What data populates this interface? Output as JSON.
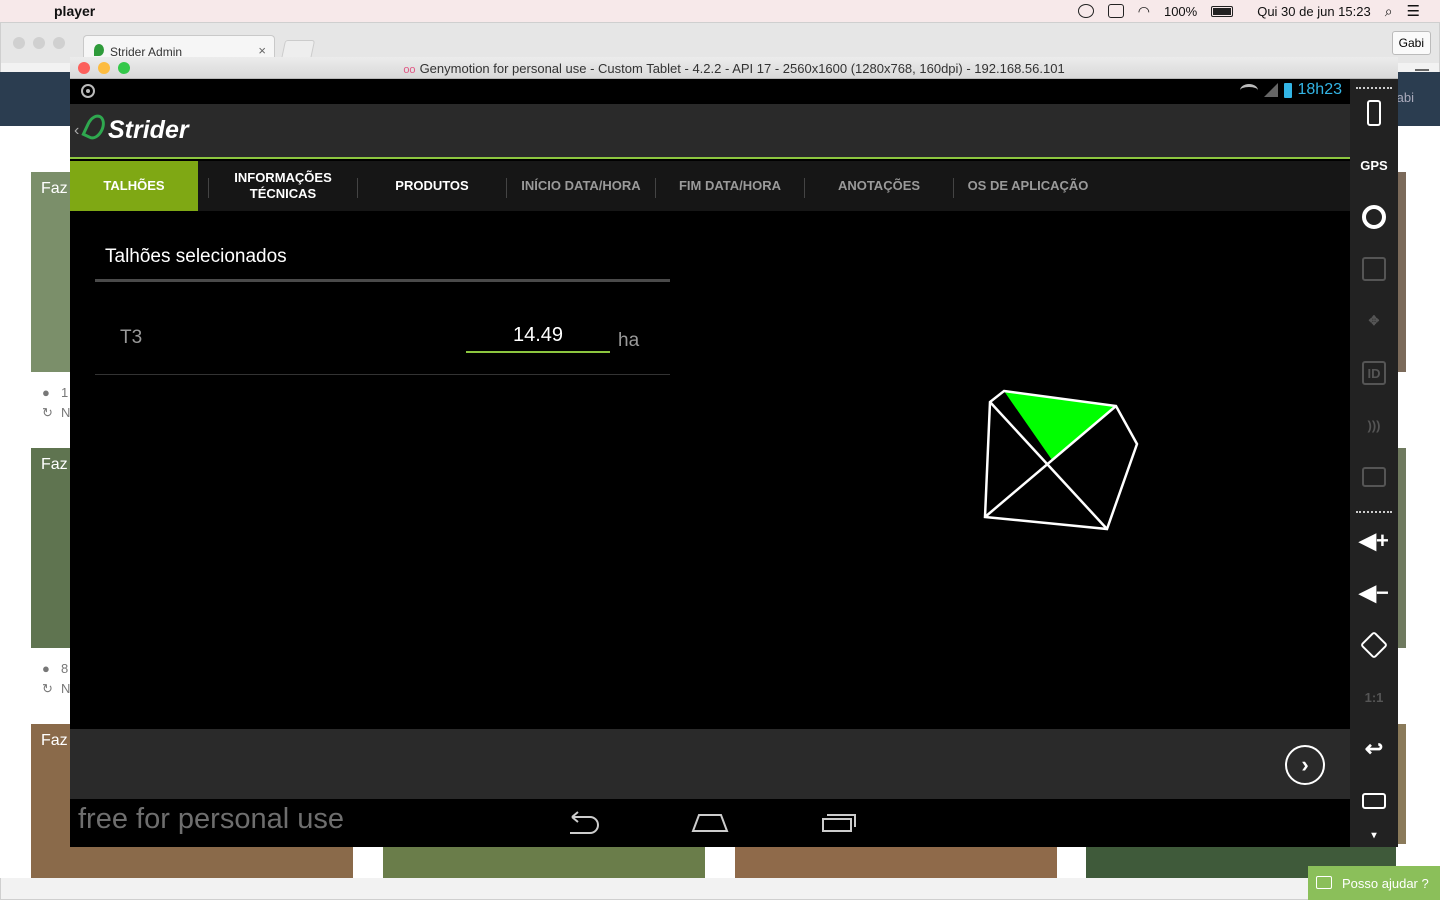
{
  "mac_menubar": {
    "app_name": "player",
    "battery": "100%",
    "datetime": "Qui 30 de jun  15:23"
  },
  "browser": {
    "tab_title": "Strider Admin",
    "user_button": "Gabi",
    "header_user": "abi",
    "cards": [
      {
        "title": "Faz",
        "info1": "1",
        "info2": "N"
      },
      {
        "title": "Faz",
        "info1": "8",
        "info2": "N"
      },
      {
        "title": "Faz"
      }
    ],
    "help_label": "Posso ajudar ?"
  },
  "genymotion": {
    "title": "Genymotion for personal use - Custom Tablet - 4.2.2 - API 17 - 2560x1600 (1280x768, 160dpi) - 192.168.56.101"
  },
  "android": {
    "clock": "18h23",
    "app_title": "Strider",
    "tabs": [
      {
        "label": "TALHÕES",
        "state": "active"
      },
      {
        "label": "INFORMAÇÕES TÉCNICAS",
        "state": "enabled"
      },
      {
        "label": "PRODUTOS",
        "state": "enabled"
      },
      {
        "label": "INÍCIO DATA/HORA",
        "state": "disabled"
      },
      {
        "label": "FIM DATA/HORA",
        "state": "disabled"
      },
      {
        "label": "ANOTAÇÕES",
        "state": "disabled"
      },
      {
        "label": "OS DE APLICAÇÃO",
        "state": "disabled"
      }
    ],
    "section_title": "Talhões selecionados",
    "rows": [
      {
        "name": "T3",
        "value": "14.49",
        "unit": "ha"
      }
    ],
    "watermark": "free for personal use",
    "next_icon": "chevron-right-icon"
  },
  "colors": {
    "accent_green": "#7fa814",
    "field_highlight": "#00ff00",
    "clock_blue": "#33b5e5"
  }
}
